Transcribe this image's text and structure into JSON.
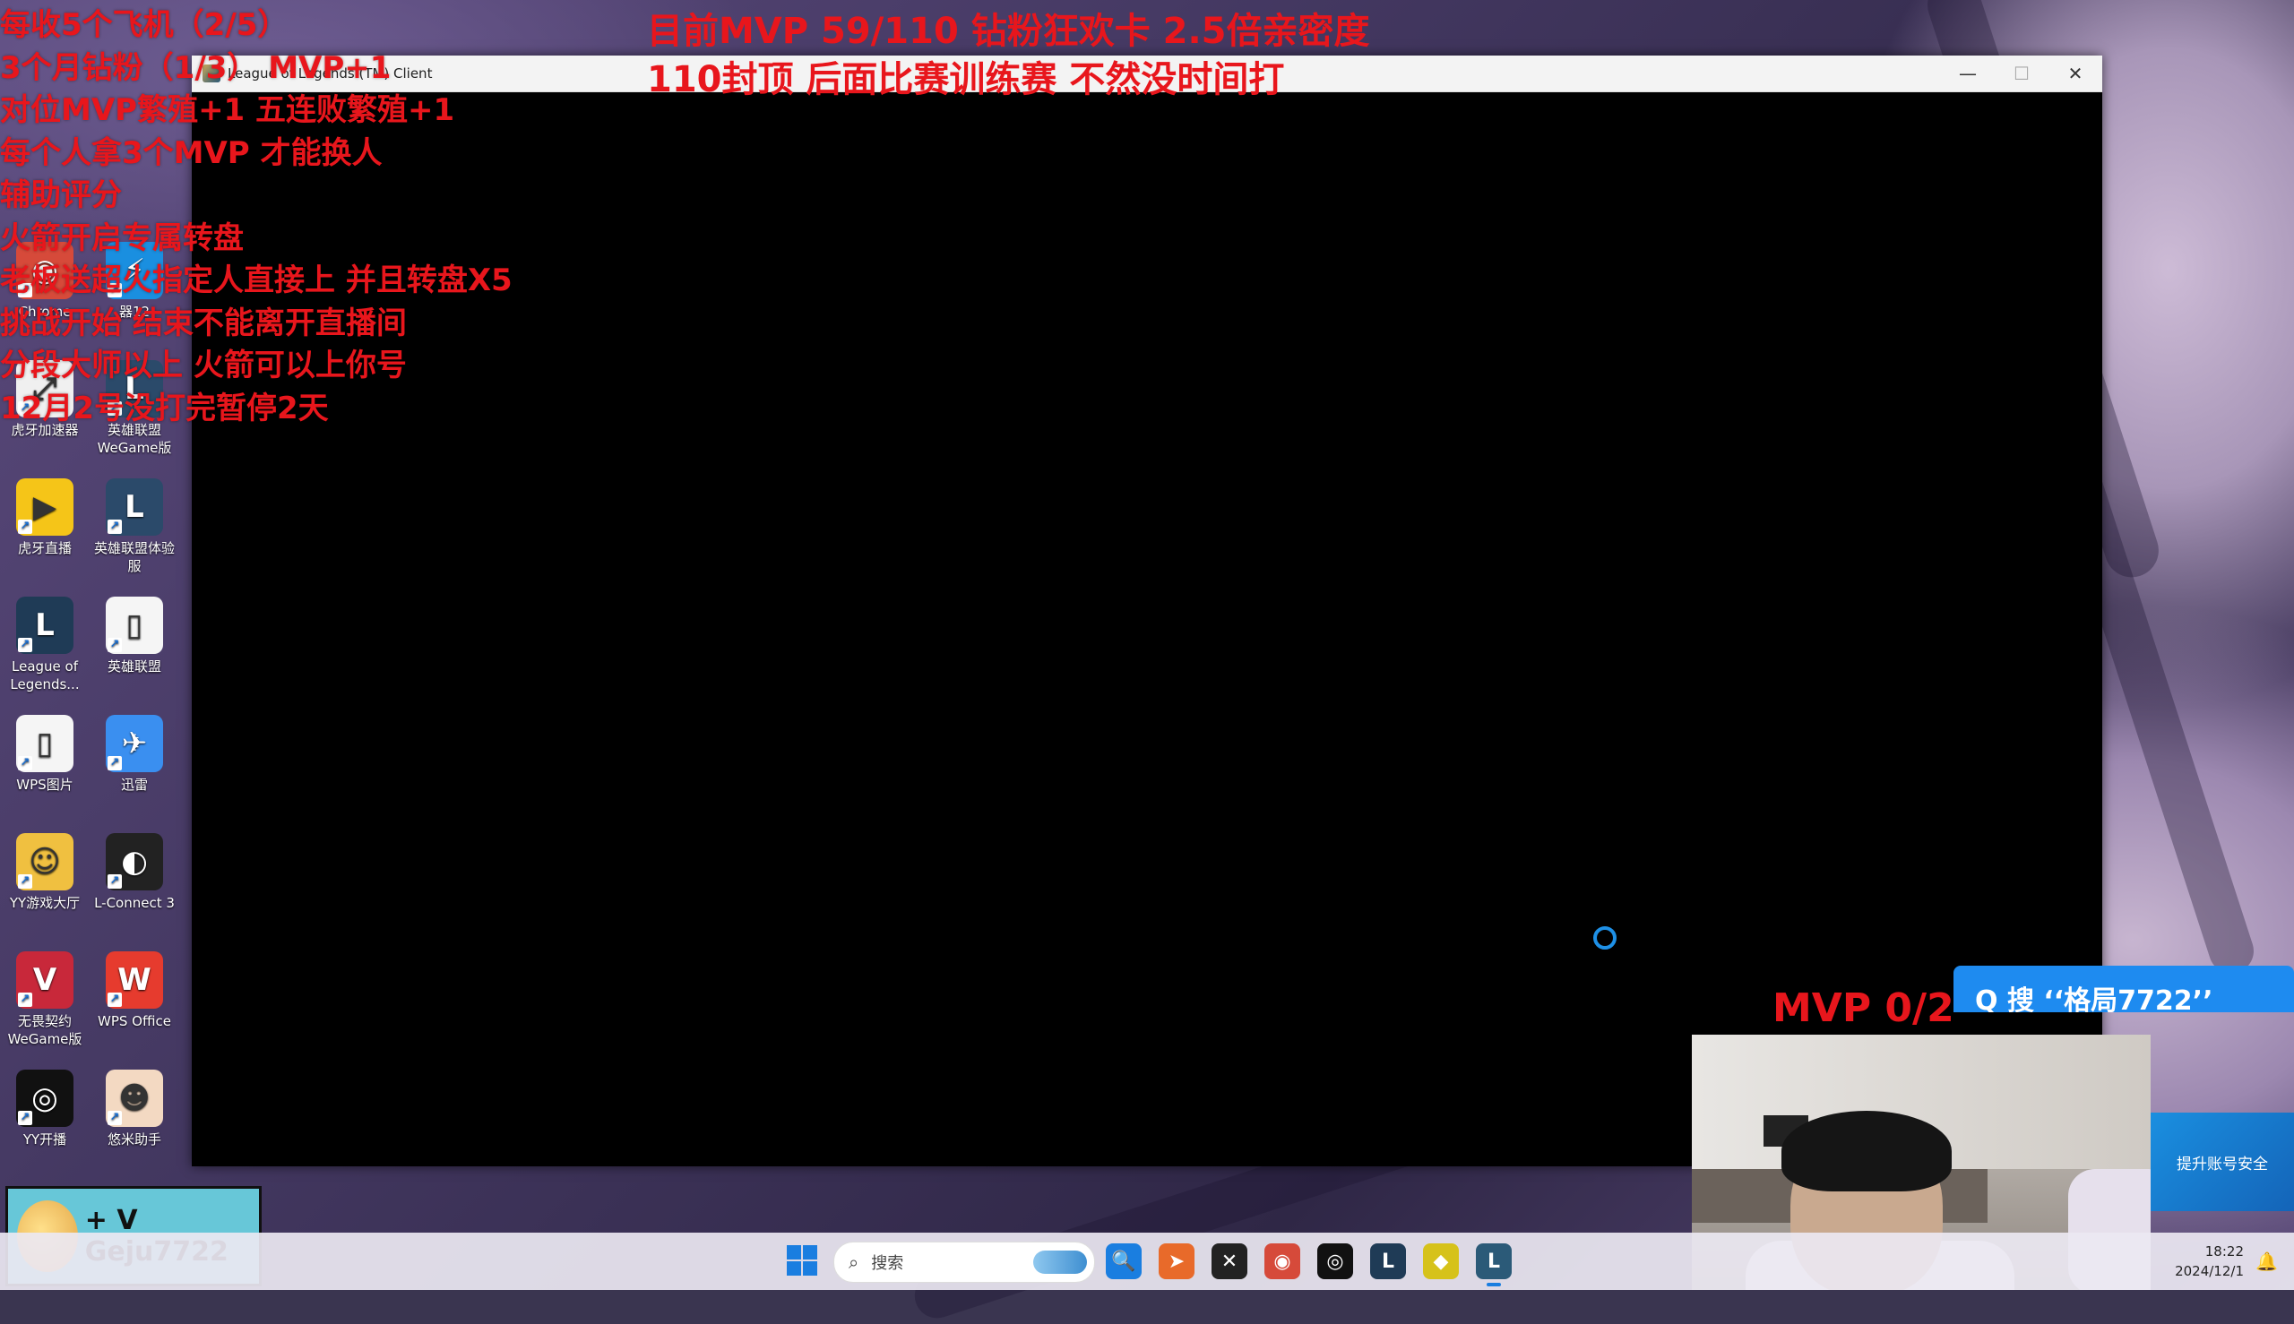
{
  "overlay": {
    "left_lines": [
      "每收5个飞机（2/5）",
      "3个月钻粉（1/3） MVP+1",
      "对位MVP繁殖+1 五连败繁殖+1",
      "每个人拿3个MVP 才能换人",
      "辅助评分",
      "火箭开启专属转盘",
      "老板送超火指定人直接上 并且转盘X5",
      "挑战开始 结束不能离开直播间",
      "分段大师以上 火箭可以上你号",
      "12月2号没打完暂停2天"
    ],
    "top_line_1": "目前MVP 59/110  钻粉狂欢卡 2.5倍亲密度",
    "top_line_2": "110封顶 后面比赛训练赛 不然没时间打",
    "mvp_counter": "MVP 0/2"
  },
  "desktop_icons": [
    {
      "label": "Chrome",
      "icon": "chrome-icon",
      "color": "#d64a3a",
      "glyph": "◉"
    },
    {
      "label": "器12",
      "icon": "app-blue-icon",
      "color": "#1a8fe0",
      "glyph": "⚡"
    },
    {
      "label": "虎牙加速器",
      "icon": "huya-accelerator-icon",
      "color": "#f0f0f0",
      "glyph": "⤢"
    },
    {
      "label": "英雄联盟WeGame版",
      "icon": "lol-wegame-icon",
      "color": "#2b4a6a",
      "glyph": "L"
    },
    {
      "label": "虎牙直播",
      "icon": "huya-live-icon",
      "color": "#f5c518",
      "glyph": "▶"
    },
    {
      "label": "英雄联盟体验服",
      "icon": "lol-pbe-icon",
      "color": "#2b4a6a",
      "glyph": "L"
    },
    {
      "label": "League of Legends...",
      "icon": "league-of-legends-icon",
      "color": "#1f3b56",
      "glyph": "L"
    },
    {
      "label": "英雄联盟",
      "icon": "file-icon",
      "color": "#f5f5f5",
      "glyph": "▯"
    },
    {
      "label": "WPS图片",
      "icon": "wps-image-icon",
      "color": "#f5f5f5",
      "glyph": "▯"
    },
    {
      "label": "迅雷",
      "icon": "thunder-icon",
      "color": "#3a8ff0",
      "glyph": "✈"
    },
    {
      "label": "YY游戏大厅",
      "icon": "yy-game-hall-icon",
      "color": "#f0c040",
      "glyph": "☺"
    },
    {
      "label": "L-Connect 3",
      "icon": "l-connect-icon",
      "color": "#222222",
      "glyph": "◐"
    },
    {
      "label": "无畏契约WeGame版",
      "icon": "valorant-wegame-icon",
      "color": "#c8283a",
      "glyph": "V"
    },
    {
      "label": "WPS Office",
      "icon": "wps-office-icon",
      "color": "#e63b2e",
      "glyph": "W"
    },
    {
      "label": "YY开播",
      "icon": "yy-live-icon",
      "color": "#111111",
      "glyph": "◎"
    },
    {
      "label": "悠米助手",
      "icon": "youmi-assistant-icon",
      "color": "#f3d9c2",
      "glyph": "☻"
    }
  ],
  "window": {
    "title": "League of Legends (TM) Client",
    "minimize": "—",
    "maximize": "☐",
    "close": "✕"
  },
  "promo": {
    "banner_text": "Q 搜 ‘‘格局7722’’",
    "security_tile": "提升账号安全",
    "badge_text": "+ V Geju7722"
  },
  "taskbar": {
    "search_placeholder": "搜索",
    "time": "18:22",
    "date": "2024/12/1",
    "apps": [
      {
        "icon": "search-app-icon",
        "color": "#1a7ee0",
        "glyph": "🔍"
      },
      {
        "icon": "browser-fox-icon",
        "color": "#e86a2a",
        "glyph": "➤"
      },
      {
        "icon": "capcut-icon",
        "color": "#222222",
        "glyph": "✕"
      },
      {
        "icon": "chrome-icon",
        "color": "#d64a3a",
        "glyph": "◉"
      },
      {
        "icon": "yy-live-icon",
        "color": "#111111",
        "glyph": "◎"
      },
      {
        "icon": "league-of-legends-icon",
        "color": "#1f3b56",
        "glyph": "L"
      },
      {
        "icon": "game-yellow-icon",
        "color": "#d6c21a",
        "glyph": "◆"
      },
      {
        "icon": "league-client-icon",
        "color": "#2b5a78",
        "glyph": "L"
      }
    ]
  }
}
